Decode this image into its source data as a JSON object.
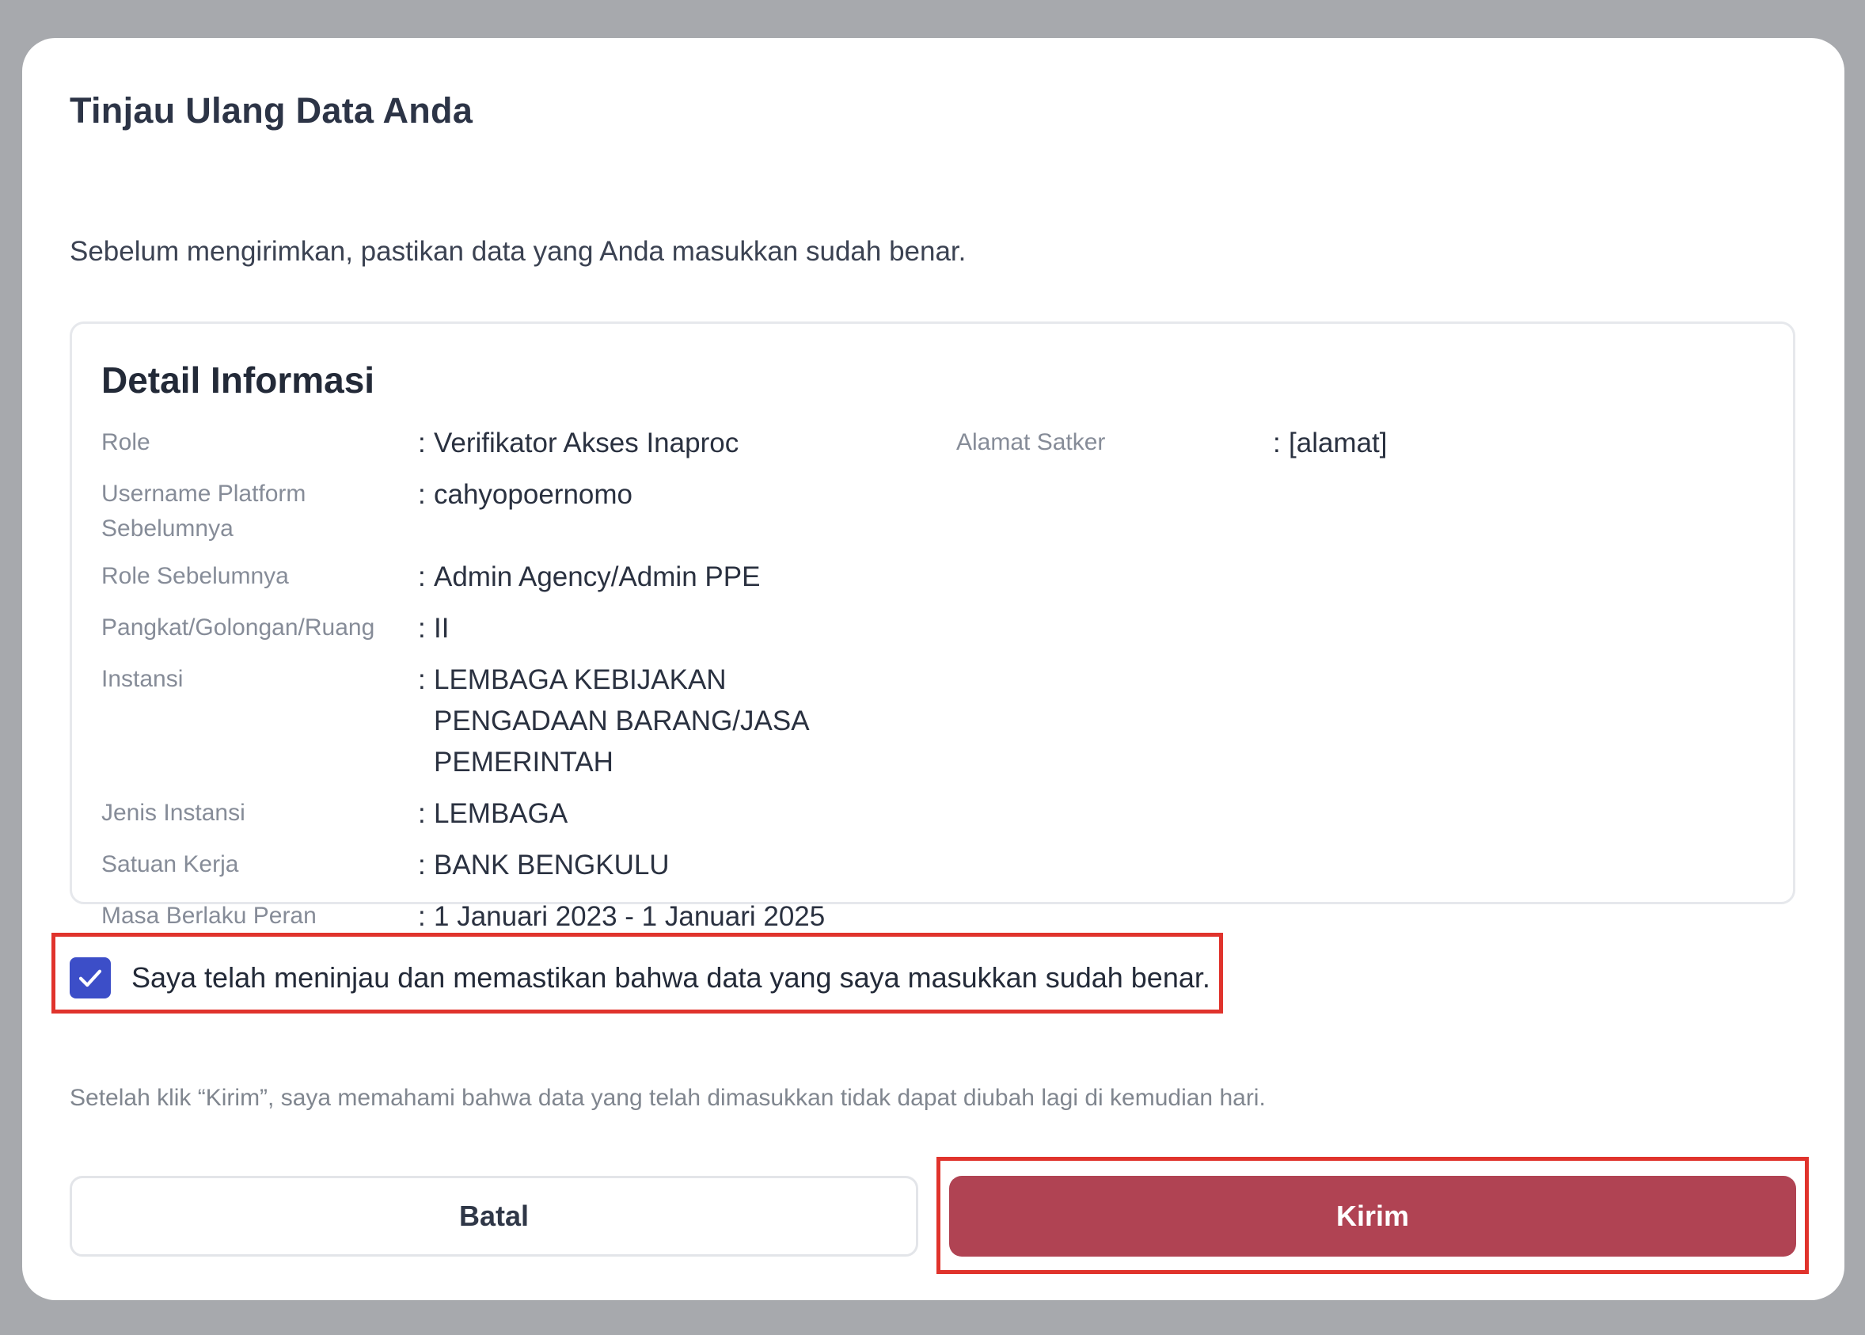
{
  "modal": {
    "title": "Tinjau Ulang Data Anda",
    "subtitle": "Sebelum mengirimkan, pastikan data yang Anda masukkan sudah benar."
  },
  "detail": {
    "title": "Detail Informasi",
    "separator": ":",
    "rows": [
      {
        "label": "Role",
        "value": "Verifikator Akses Inaproc"
      },
      {
        "label": "Username Platform Sebelumnya",
        "value": "cahyopoernomo"
      },
      {
        "label": "Role Sebelumnya",
        "value": "Admin Agency/Admin PPE"
      },
      {
        "label": "Pangkat/Golongan/Ruang",
        "value": "II"
      },
      {
        "label": "Instansi",
        "value": "LEMBAGA KEBIJAKAN PENGADAAN BARANG/JASA PEMERINTAH"
      },
      {
        "label": "Jenis Instansi",
        "value": "LEMBAGA"
      },
      {
        "label": "Satuan Kerja",
        "value": "BANK BENGKULU"
      },
      {
        "label": "Masa Berlaku Peran",
        "value": "1 Januari 2023 - 1 Januari 2025"
      }
    ],
    "side": {
      "label": "Alamat Satker",
      "value": "[alamat]"
    }
  },
  "confirm": {
    "checked": true,
    "label": "Saya telah meninjau dan memastikan bahwa data yang saya masukkan sudah benar."
  },
  "note": "Setelah klik “Kirim”, saya memahami bahwa data yang telah dimasukkan tidak dapat diubah lagi di kemudian hari.",
  "buttons": {
    "cancel_label": "Batal",
    "submit_label": "Kirim"
  },
  "icons": {
    "checkbox": "check-icon"
  },
  "colors": {
    "accent": "#3c4ec8",
    "submit": "#b04353",
    "highlight": "#e0332c"
  }
}
